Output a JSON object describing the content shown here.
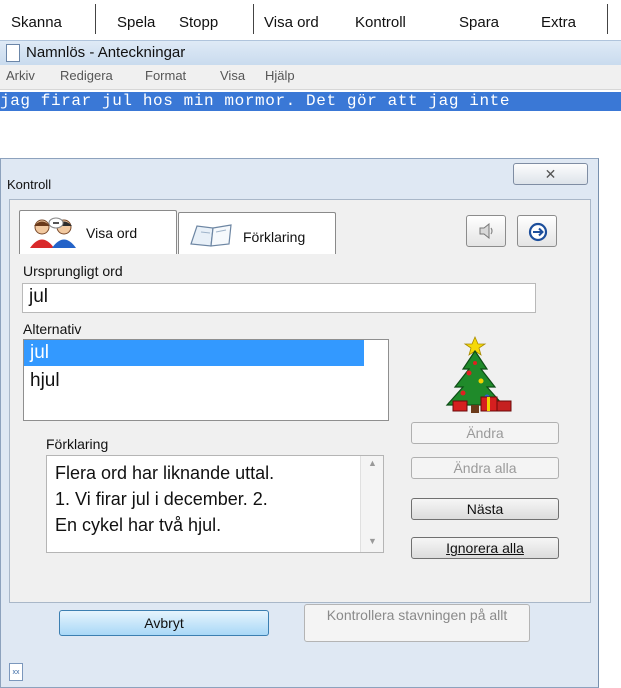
{
  "toolbar": {
    "skanna": "Skanna",
    "spela": "Spela",
    "stopp": "Stopp",
    "visa_ord": "Visa ord",
    "kontroll": "Kontroll",
    "spara": "Spara",
    "extra": "Extra"
  },
  "notepad": {
    "title": "Namnlös - Anteckningar",
    "menu": [
      "Arkiv",
      "Redigera",
      "Format",
      "Visa",
      "Hjälp"
    ],
    "text": "jag firar jul hos min mormor. Det gör att jag inte"
  },
  "dialog": {
    "title": "Kontroll",
    "close_glyph": "✕",
    "tabs": {
      "visa_ord": "Visa ord",
      "forklaring": "Förklaring"
    },
    "original_label": "Ursprungligt ord",
    "original_value": "jul",
    "alternatives_label": "Alternativ",
    "alternatives": [
      "jul",
      "hjul"
    ],
    "selected_alternative_index": 0,
    "explanation_label": "Förklaring",
    "explanation": "Flera ord har liknande uttal.\n1. Vi firar jul i december. 2.\nEn cykel har två hjul.",
    "buttons": {
      "andra": "Ändra",
      "andra_alla": "Ändra alla",
      "nasta": "Nästa",
      "ignorera_alla": "Ignorera alla",
      "avbryt": "Avbryt",
      "kontrollera": "Kontrollera stavningen på allt"
    },
    "icons": {
      "speaker": "speaker-icon",
      "arrow": "arrow-right-circle-icon",
      "tree": "christmas-tree-icon",
      "status": "document-icon"
    },
    "colors": {
      "selection": "#3399ff",
      "notepad_highlight": "#3a78d6",
      "dialog_bg": "#dfe8f3"
    }
  }
}
